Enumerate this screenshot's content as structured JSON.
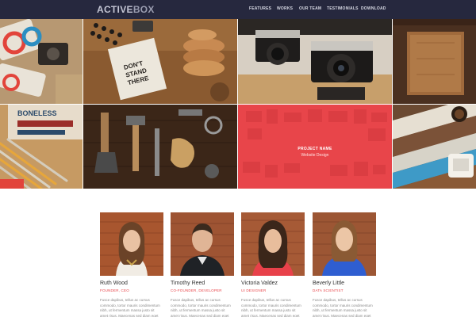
{
  "brand": {
    "part1": "ACTIVE",
    "part2": "BOX"
  },
  "nav": {
    "items": [
      {
        "label": "FEATURES"
      },
      {
        "label": "WORKS"
      },
      {
        "label": "OUR TEAM"
      },
      {
        "label": "TESTIMONIALS"
      },
      {
        "label": "DOWNLOAD"
      }
    ]
  },
  "portfolio": {
    "tiles": [
      {
        "image": "colorful-stickers-photo"
      },
      {
        "image": "coasters-and-notebook-photo",
        "text": "DON'T STAND THERE"
      },
      {
        "image": "vintage-cameras-photo"
      },
      {
        "image": "wooden-board-photo"
      },
      {
        "image": "pencils-and-sign-photo",
        "text": "BONELESS"
      },
      {
        "image": "tools-on-wood-photo"
      },
      {
        "image": "project-overlay",
        "title": "PROJECT NAME",
        "subtitle": "Website Design"
      },
      {
        "image": "painted-wood-and-coffee-photo"
      }
    ]
  },
  "team": {
    "members": [
      {
        "name": "Ruth Wood",
        "role": "FOUNDER, CEO",
        "bio": "Fusce dapibus, tellus ac cursus commodo, tortor mauris condimentum nibh, ut fermentum massa justo sit amet risus. Maecenas sed diam eget risus."
      },
      {
        "name": "Timothy Reed",
        "role": "CO-FOUNDER, DEVELOPER",
        "bio": "Fusce dapibus, tellus ac cursus commodo, tortor mauris condimentum nibh, ut fermentum massa justo sit amet risus. Maecenas sed diam eget risus."
      },
      {
        "name": "Victoria Valdez",
        "role": "UI DESIGNER",
        "bio": "Fusce dapibus, tellus ac cursus commodo, tortor mauris condimentum nibh, ut fermentum massa justo sit amet risus. Maecenas sed diam eget risus."
      },
      {
        "name": "Beverly Little",
        "role": "DATA SCIENTIST",
        "bio": "Fusce dapibus, tellus ac cursus commodo, tortor mauris condimentum nibh, ut fermentum massa justo sit amet risus. Maecenas sed diam eget risus."
      }
    ]
  },
  "colors": {
    "nav_bg": "#26283e",
    "accent": "#e8454a"
  }
}
